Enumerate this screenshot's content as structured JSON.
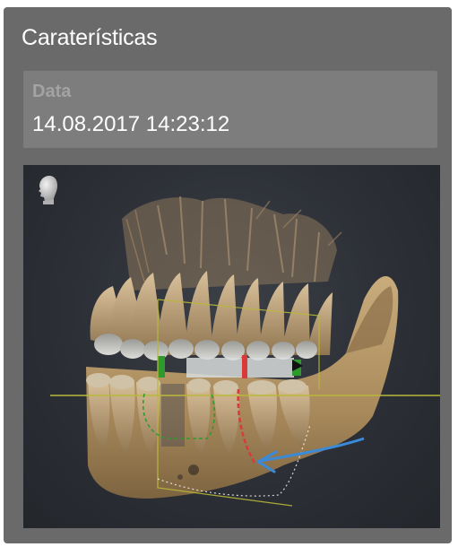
{
  "panel": {
    "title": "Caraterísticas"
  },
  "property": {
    "label": "Data",
    "value": "14.08.2017 14:23:12"
  },
  "viewport": {
    "icon": "head-orientation-icon",
    "content": "3d-volume-rendering",
    "colors": {
      "background": "#2c3036",
      "bone": "#b89a6c",
      "crosshair": "#b8b83a",
      "canal_marker": "#d83a3a",
      "arrow": "#3a8ad8"
    }
  }
}
